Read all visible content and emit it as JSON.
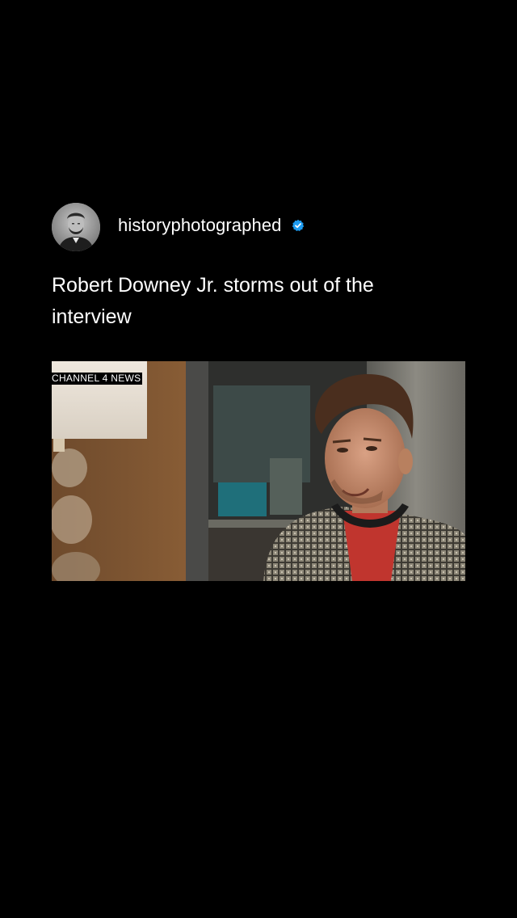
{
  "post": {
    "username": "historyphotographed",
    "verified": true,
    "caption": "Robert Downey Jr. storms out of the interview",
    "avatar_icon": "portrait-avatar",
    "verified_icon": "verified-badge-icon",
    "verified_color": "#1d9bf0"
  },
  "media": {
    "watermark": "CHANNEL 4 NEWS"
  }
}
